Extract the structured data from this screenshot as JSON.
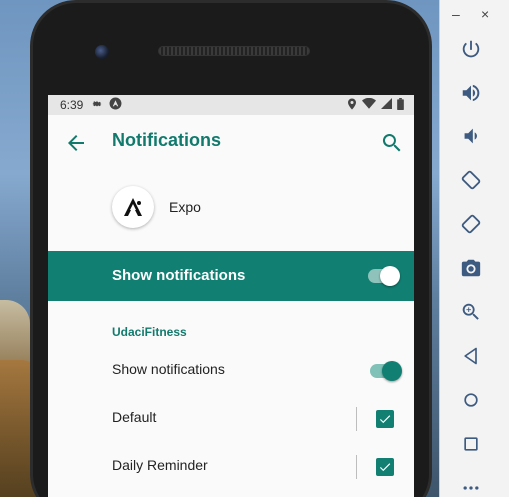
{
  "status_bar": {
    "time": "6:39",
    "icons": [
      "settings-icon",
      "a-icon"
    ],
    "right_icons": [
      "location-icon",
      "wifi-icon",
      "signal-icon",
      "battery-icon"
    ]
  },
  "app_bar": {
    "title": "Notifications",
    "back_icon": "arrow-back-icon",
    "search_icon": "search-icon"
  },
  "app": {
    "name": "Expo"
  },
  "master_toggle": {
    "label": "Show notifications",
    "on": true
  },
  "category": {
    "title": "UdaciFitness",
    "rows": [
      {
        "label": "Show notifications",
        "control": "switch",
        "on": true
      },
      {
        "label": "Default",
        "control": "checkbox",
        "checked": true
      },
      {
        "label": "Daily Reminder",
        "control": "checkbox",
        "checked": true
      }
    ]
  },
  "emulator_panel": {
    "window_controls": [
      "–",
      "×"
    ],
    "tools": [
      "power-icon",
      "volume-up-icon",
      "volume-down-icon",
      "rotate-left-icon",
      "rotate-right-icon",
      "camera-icon",
      "zoom-icon",
      "back-icon",
      "home-icon",
      "overview-icon",
      "more-icon"
    ]
  },
  "colors": {
    "accent": "#117a6d",
    "accent_bar": "#117f72",
    "switch_track": "#80c1b8"
  }
}
